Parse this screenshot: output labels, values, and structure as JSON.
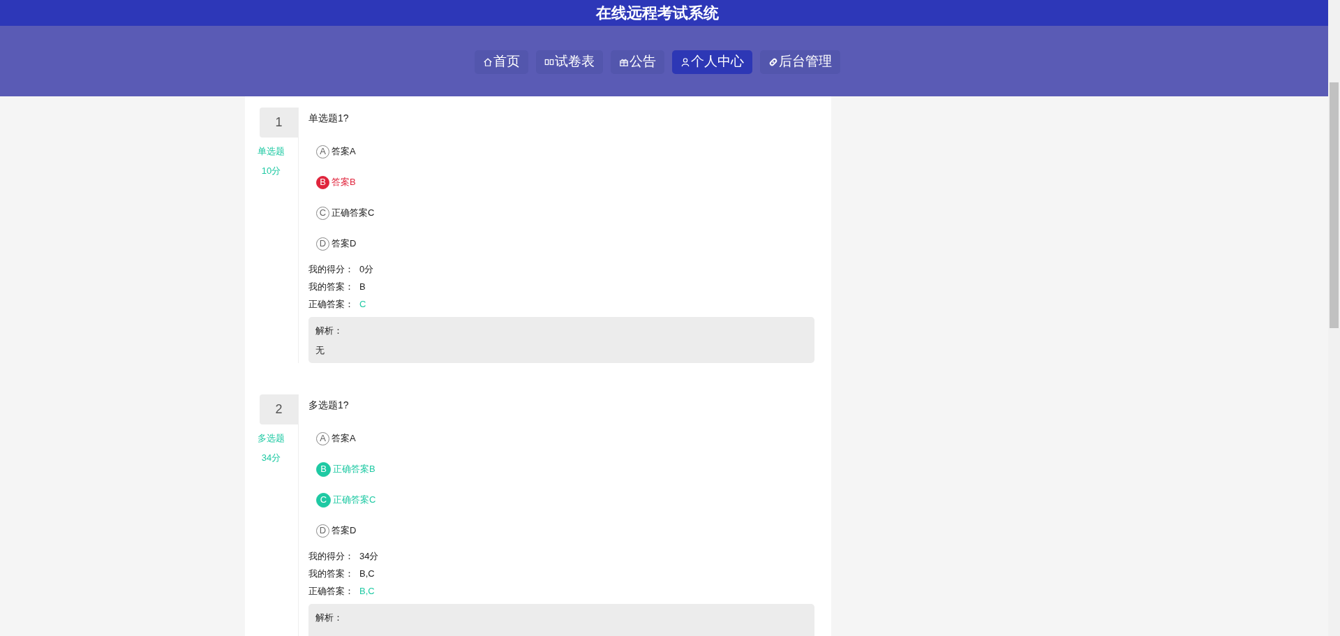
{
  "header": {
    "title": "在线远程考试系统"
  },
  "nav": [
    {
      "kind": "home",
      "label": "首页",
      "selected": false
    },
    {
      "kind": "paper",
      "label": "试卷表",
      "selected": false
    },
    {
      "kind": "notice",
      "label": "公告",
      "selected": false
    },
    {
      "kind": "profile",
      "label": "个人中心",
      "selected": true
    },
    {
      "kind": "admin",
      "label": "后台管理",
      "selected": false
    }
  ],
  "questions": [
    {
      "number": "1",
      "type": "单选题",
      "points": "10分",
      "text": "单选题1?",
      "options": [
        {
          "letter": "A",
          "text": "答案A",
          "kind": "plain"
        },
        {
          "letter": "B",
          "text": "答案B",
          "kind": "wrong"
        },
        {
          "letter": "C",
          "text": "正确答案C",
          "kind": "plain"
        },
        {
          "letter": "D",
          "text": "答案D",
          "kind": "plain"
        }
      ],
      "results": [
        {
          "label": "我的得分：",
          "value": "0分",
          "correct": false
        },
        {
          "label": "我的答案：",
          "value": "B",
          "correct": false
        },
        {
          "label": "正确答案：",
          "value": "C",
          "correct": true
        }
      ],
      "analysis": {
        "label": "解析：",
        "text": "无"
      }
    },
    {
      "number": "2",
      "type": "多选题",
      "points": "34分",
      "text": "多选题1?",
      "options": [
        {
          "letter": "A",
          "text": "答案A",
          "kind": "plain"
        },
        {
          "letter": "B",
          "text": "正确答案B",
          "kind": "right"
        },
        {
          "letter": "C",
          "text": "正确答案C",
          "kind": "right"
        },
        {
          "letter": "D",
          "text": "答案D",
          "kind": "plain"
        }
      ],
      "results": [
        {
          "label": "我的得分：",
          "value": "34分",
          "correct": false
        },
        {
          "label": "我的答案：",
          "value": "B,C",
          "correct": false
        },
        {
          "label": "正确答案：",
          "value": "B,C",
          "correct": true
        }
      ],
      "analysis": {
        "label": "解析："
      }
    }
  ]
}
